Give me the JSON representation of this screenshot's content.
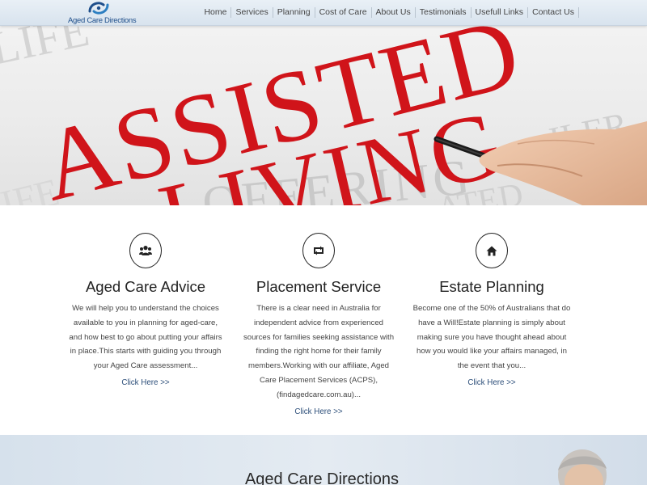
{
  "brand": {
    "name": "Aged Care Directions",
    "color": "#1f4f8b"
  },
  "nav": {
    "items": [
      {
        "label": "Home"
      },
      {
        "label": "Services"
      },
      {
        "label": "Planning"
      },
      {
        "label": "Cost of Care"
      },
      {
        "label": "About Us"
      },
      {
        "label": "Testimonials"
      },
      {
        "label": "Usefull Links"
      },
      {
        "label": "Contact Us"
      }
    ]
  },
  "hero": {
    "headline_top": "ASSISTED",
    "headline_bottom": "LIVING",
    "background_words": [
      "LIFE",
      "OFFERING",
      "LIFE",
      "ATED",
      "ILER"
    ],
    "accent": "#d0141a"
  },
  "services": [
    {
      "icon": "users-icon",
      "title": "Aged Care Advice",
      "description": "We will help you to understand the choices available to you in planning for aged-care, and how best to go about putting your affairs in place.This starts with guiding you through your Aged Care assessment...",
      "link": "Click Here >>"
    },
    {
      "icon": "retweet-icon",
      "title": "Placement Service",
      "description": "There is a clear need in Australia for independent advice from experienced sources for families seeking assistance with finding the right home for their family members.Working with our affiliate, Aged Care Placement Services (ACPS), (findagedcare.com.au)...",
      "link": "Click Here >>"
    },
    {
      "icon": "home-icon",
      "title": "Estate Planning",
      "description": "Become one of the 50% of Australians that do have a Will!Estate planning is simply about making sure you have thought ahead about how you would like your affairs managed, in the event that you...",
      "link": "Click Here >>"
    }
  ],
  "band": {
    "title": "Aged Care Directions"
  }
}
